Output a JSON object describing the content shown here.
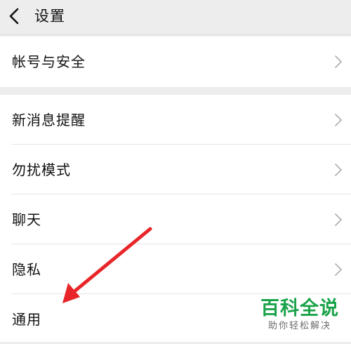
{
  "header": {
    "title": "设置",
    "back_icon": "chevron-left-icon"
  },
  "groups": [
    {
      "items": [
        {
          "label": "帐号与安全",
          "chevron": "chevron-right-icon"
        }
      ]
    },
    {
      "items": [
        {
          "label": "新消息提醒",
          "chevron": "chevron-right-icon"
        },
        {
          "label": "勿扰模式",
          "chevron": "chevron-right-icon"
        },
        {
          "label": "聊天",
          "chevron": "chevron-right-icon"
        },
        {
          "label": "隐私",
          "chevron": "chevron-right-icon"
        },
        {
          "label": "通用",
          "chevron": "chevron-right-icon"
        }
      ]
    }
  ],
  "annotation": {
    "arrow_color": "#e8262a",
    "points_to": "通用"
  },
  "watermark": {
    "title": "百科全说",
    "subtitle": "助你轻松解决",
    "color": "#1aa34a"
  },
  "colors": {
    "background": "#ededed",
    "row": "#ffffff",
    "chevron": "#b2b2b2"
  }
}
